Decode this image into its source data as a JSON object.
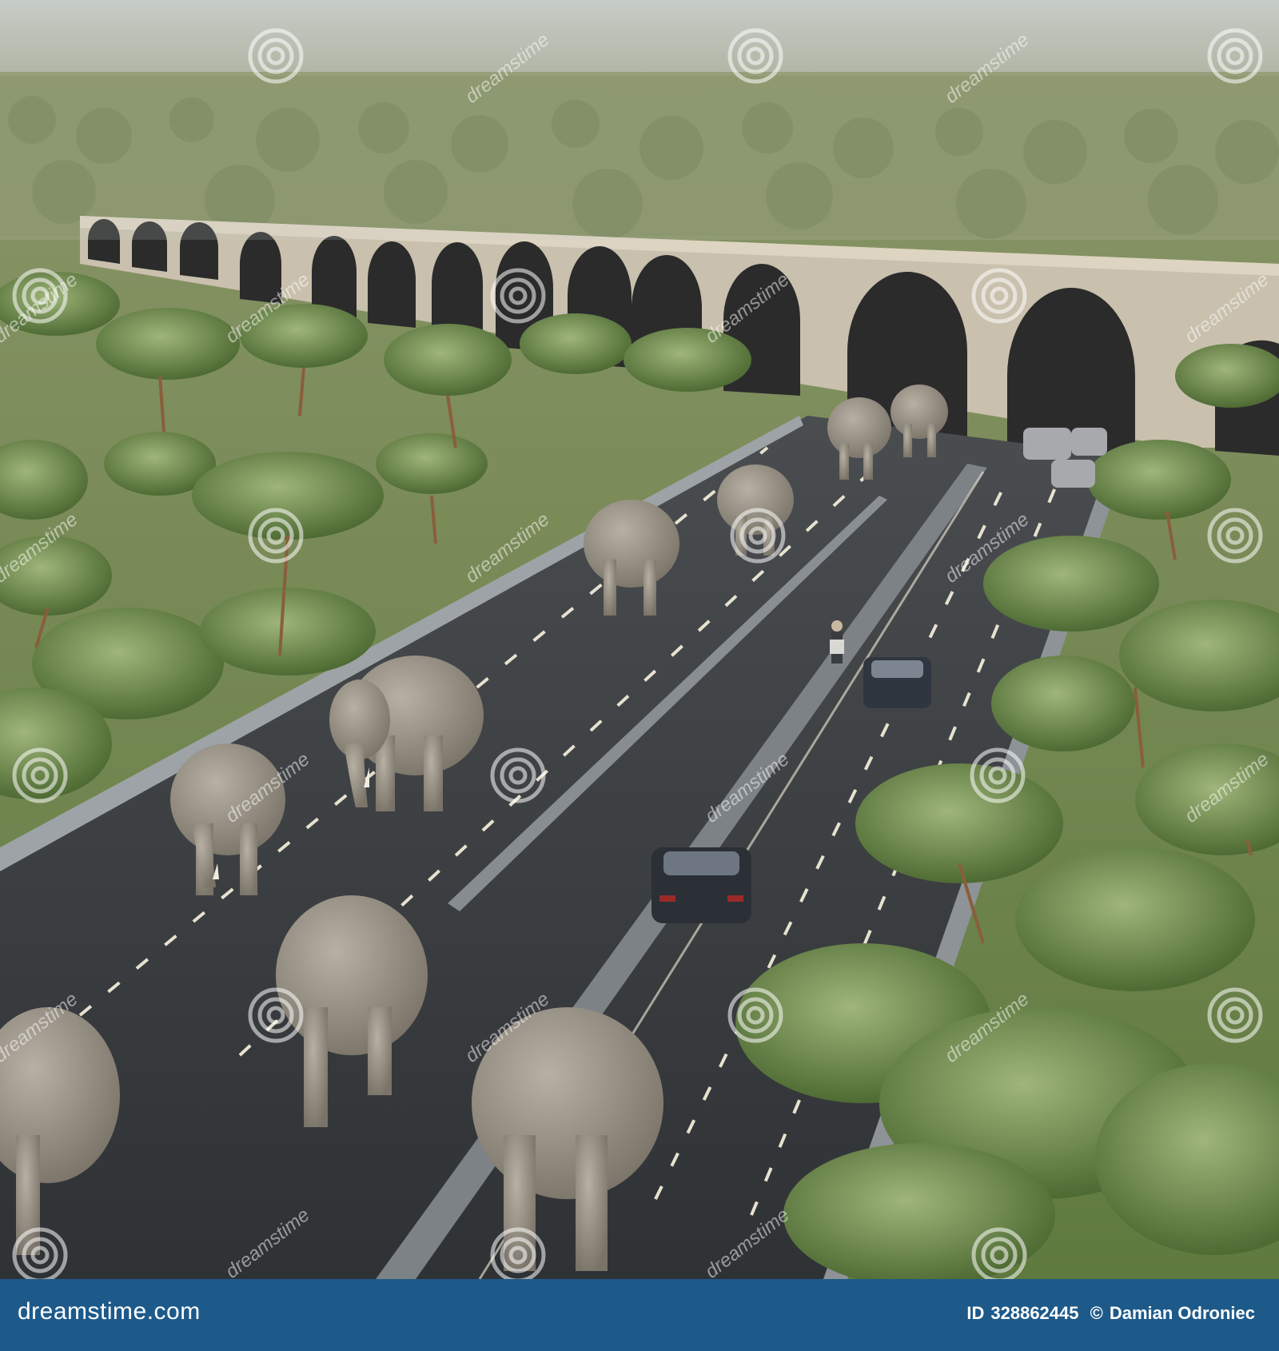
{
  "photo": {
    "subject_elements": [
      "elephant-herd",
      "highway",
      "arched-bridge",
      "savanna-trees",
      "cars",
      "pedestrian"
    ]
  },
  "watermark": {
    "text": "dreamstime",
    "icon": "spiral-icon"
  },
  "footer": {
    "brand": "dreamstime.com",
    "id_label": "ID",
    "id_value": "328862445",
    "copyright_symbol": "©",
    "author": "Damian Odroniec"
  },
  "colors": {
    "footer_bg": "#1d5a8a",
    "sky": "#c8cdc9",
    "road": "#3a3d40",
    "foliage": "#6d8a4a",
    "elephant": "#9b9489",
    "bridge": "#c9c0ad"
  }
}
